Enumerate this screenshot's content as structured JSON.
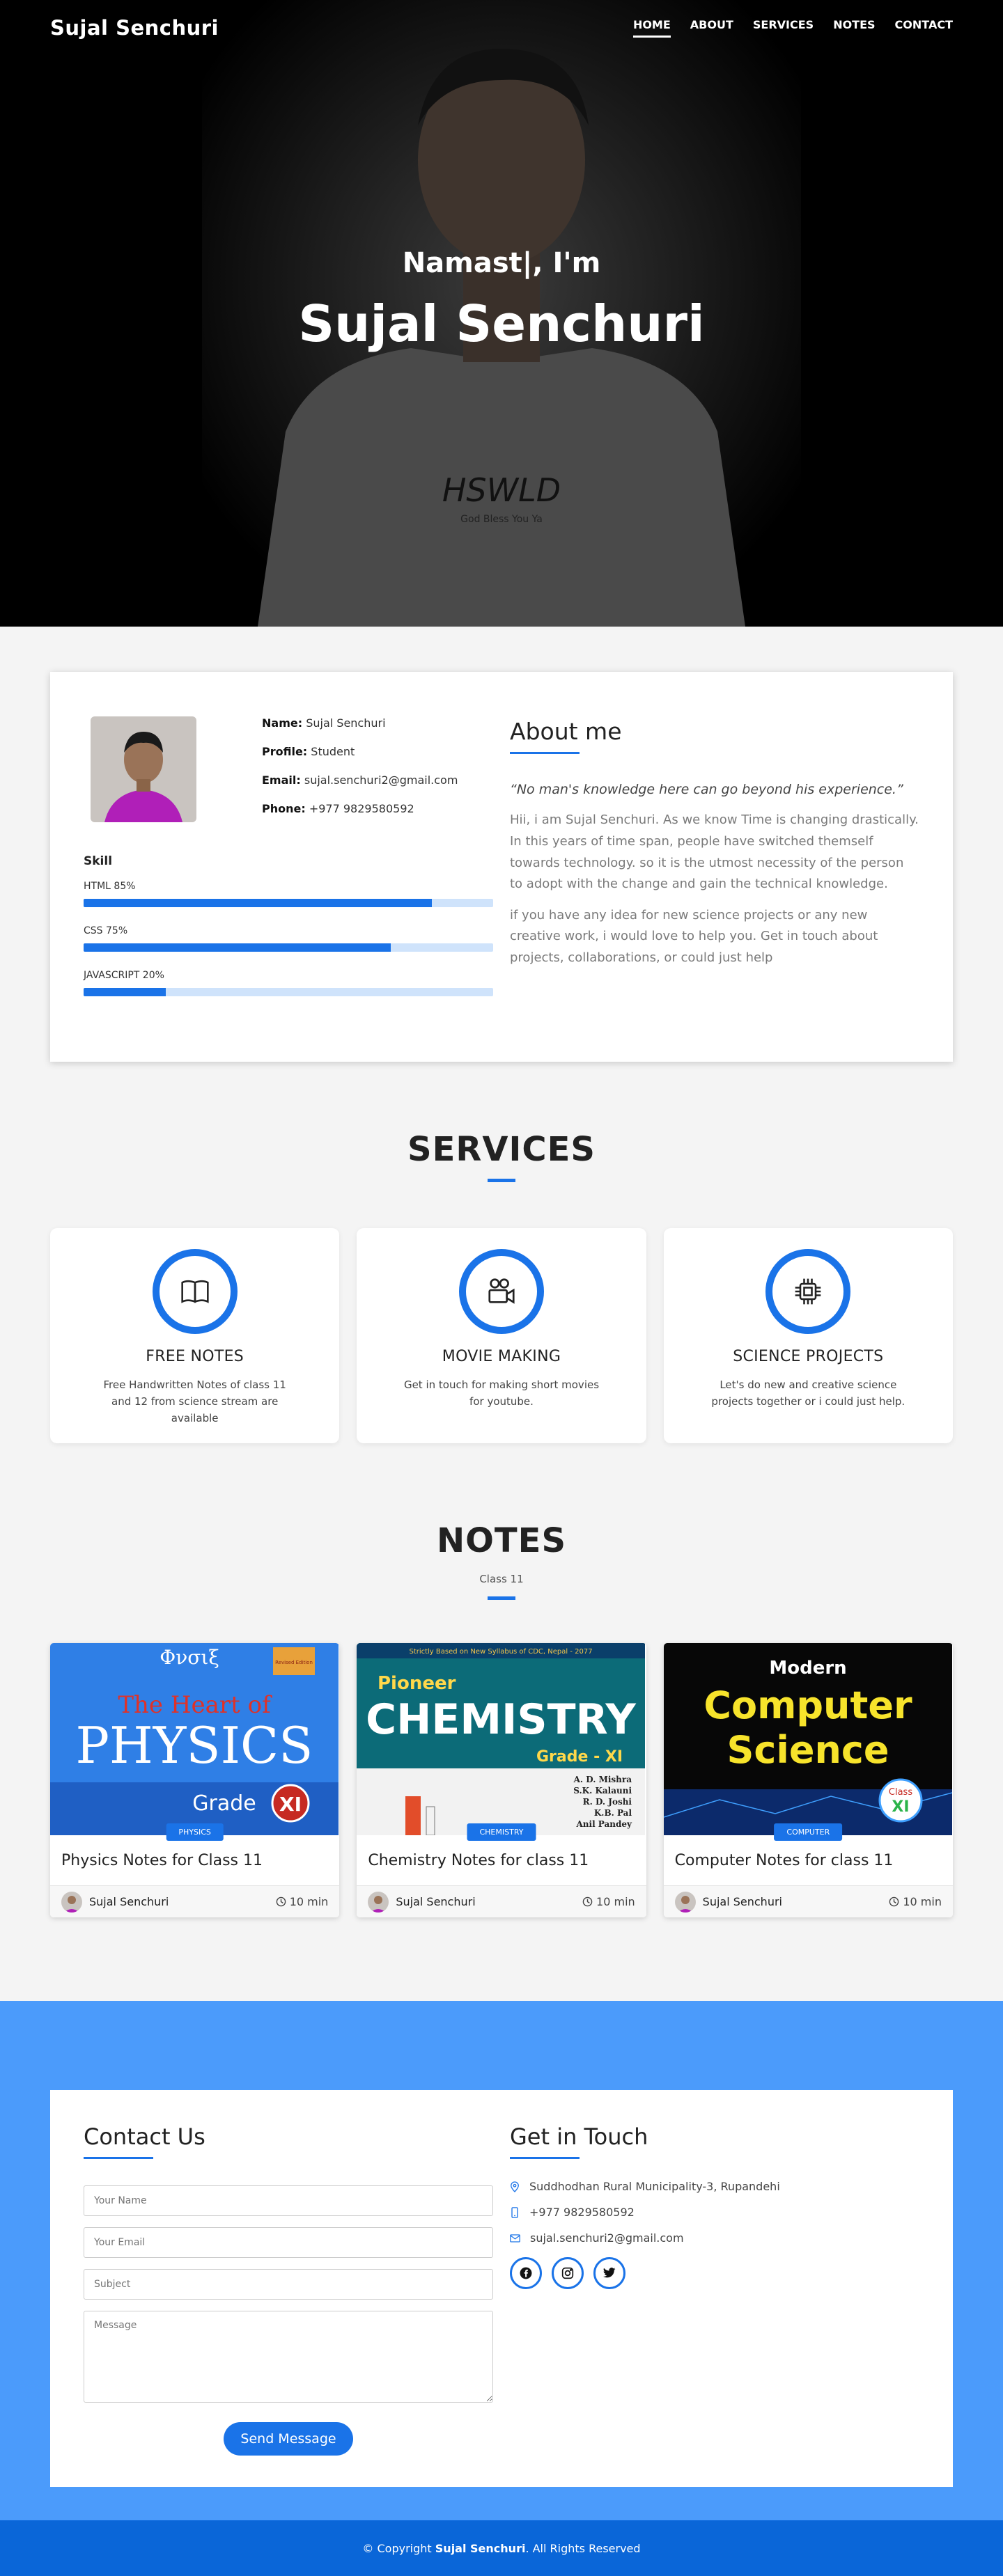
{
  "header": {
    "brand": "Sujal Senchuri",
    "nav": [
      "HOME",
      "ABOUT",
      "SERVICES",
      "NOTES",
      "CONTACT"
    ],
    "active_nav": "HOME"
  },
  "hero": {
    "greeting": "Namast|, I'm",
    "name": "Sujal Senchuri",
    "shirt_text": "HSWLD",
    "shirt_subtext": "God Bless You Ya"
  },
  "about": {
    "name_label": "Name:",
    "name_value": "Sujal Senchuri",
    "profile_label": "Profile:",
    "profile_value": "Student",
    "email_label": "Email:",
    "email_value": "sujal.senchuri2@gmail.com",
    "phone_label": "Phone:",
    "phone_value": "+977 9829580592",
    "skill_title": "Skill",
    "skills": [
      {
        "label": "HTML 85%",
        "percent": 85
      },
      {
        "label": "CSS 75%",
        "percent": 75
      },
      {
        "label": "JAVASCRIPT 20%",
        "percent": 20
      }
    ],
    "title": "About me",
    "quote": "“No man's knowledge here can go beyond his experience.”",
    "para1": "Hii, i am Sujal Senchuri. As we know Time is changing drastically. In this years of time span, people have switched themself towards technology. so it is the utmost necessity of the person to adopt with the change and gain the technical knowledge.",
    "para2": "if you have any idea for new science projects or any new creative work, i would love to help you. Get in touch about projects, collaborations, or could just help"
  },
  "services": {
    "title": "SERVICES",
    "items": [
      {
        "icon": "book-icon",
        "title": "FREE NOTES",
        "text": "Free Handwritten Notes of class 11 and 12 from science stream are available"
      },
      {
        "icon": "camera-reels-icon",
        "title": "MOVIE MAKING",
        "text": "Get in touch for making short movies for youtube."
      },
      {
        "icon": "cpu-icon",
        "title": "SCIENCE PROJECTS",
        "text": "Let's do new and creative science projects together or i could just help."
      }
    ]
  },
  "notes": {
    "title": "NOTES",
    "subtitle": "Class 11",
    "items": [
      {
        "badge": "PHYSICS",
        "title": "Physics Notes for Class 11",
        "author": "Sujal Senchuri",
        "time": "10 min",
        "cover": {
          "top": "Φνσιξ",
          "line1": "The Heart of",
          "line2": "PHYSICS",
          "line3": "Grade",
          "line4": "XI",
          "tag": "Revised Edition"
        }
      },
      {
        "badge": "CHEMISTRY",
        "title": "Chemistry Notes for class 11",
        "author": "Sujal Senchuri",
        "time": "10 min",
        "cover": {
          "top": "Strictly Based on New Syllabus of CDC, Nepal - 2077",
          "line1": "Pioneer",
          "line2": "CHEMISTRY",
          "line3": "Grade - XI",
          "authors": [
            "A. D. Mishra",
            "S.K. Kalauni",
            "R. D. Joshi",
            "K.B. Pal",
            "Anil Pandey"
          ]
        }
      },
      {
        "badge": "COMPUTER",
        "title": "Computer Notes for class 11",
        "author": "Sujal Senchuri",
        "time": "10 min",
        "cover": {
          "line1": "Modern",
          "line2": "Computer",
          "line3": "Science",
          "tag1": "Class",
          "tag2": "XI"
        }
      }
    ]
  },
  "contact": {
    "title": "Contact Us",
    "name_placeholder": "Your Name",
    "email_placeholder": "Your Email",
    "subject_placeholder": "Subject",
    "message_placeholder": "Message",
    "send_label": "Send Message",
    "touch_title": "Get in Touch",
    "address": "Suddhodhan Rural Municipality-3, Rupandehi",
    "phone": "+977 9829580592",
    "email": "sujal.senchuri2@gmail.com",
    "socials": [
      "facebook-icon",
      "instagram-icon",
      "twitter-icon"
    ]
  },
  "footer": {
    "prefix": "© Copyright ",
    "name": "Sujal Senchuri",
    "suffix": ". All Rights Reserved"
  },
  "colors": {
    "accent": "#1a73e8",
    "contact_bg": "#4b9bfb",
    "footer_bg": "#0a66d8"
  }
}
